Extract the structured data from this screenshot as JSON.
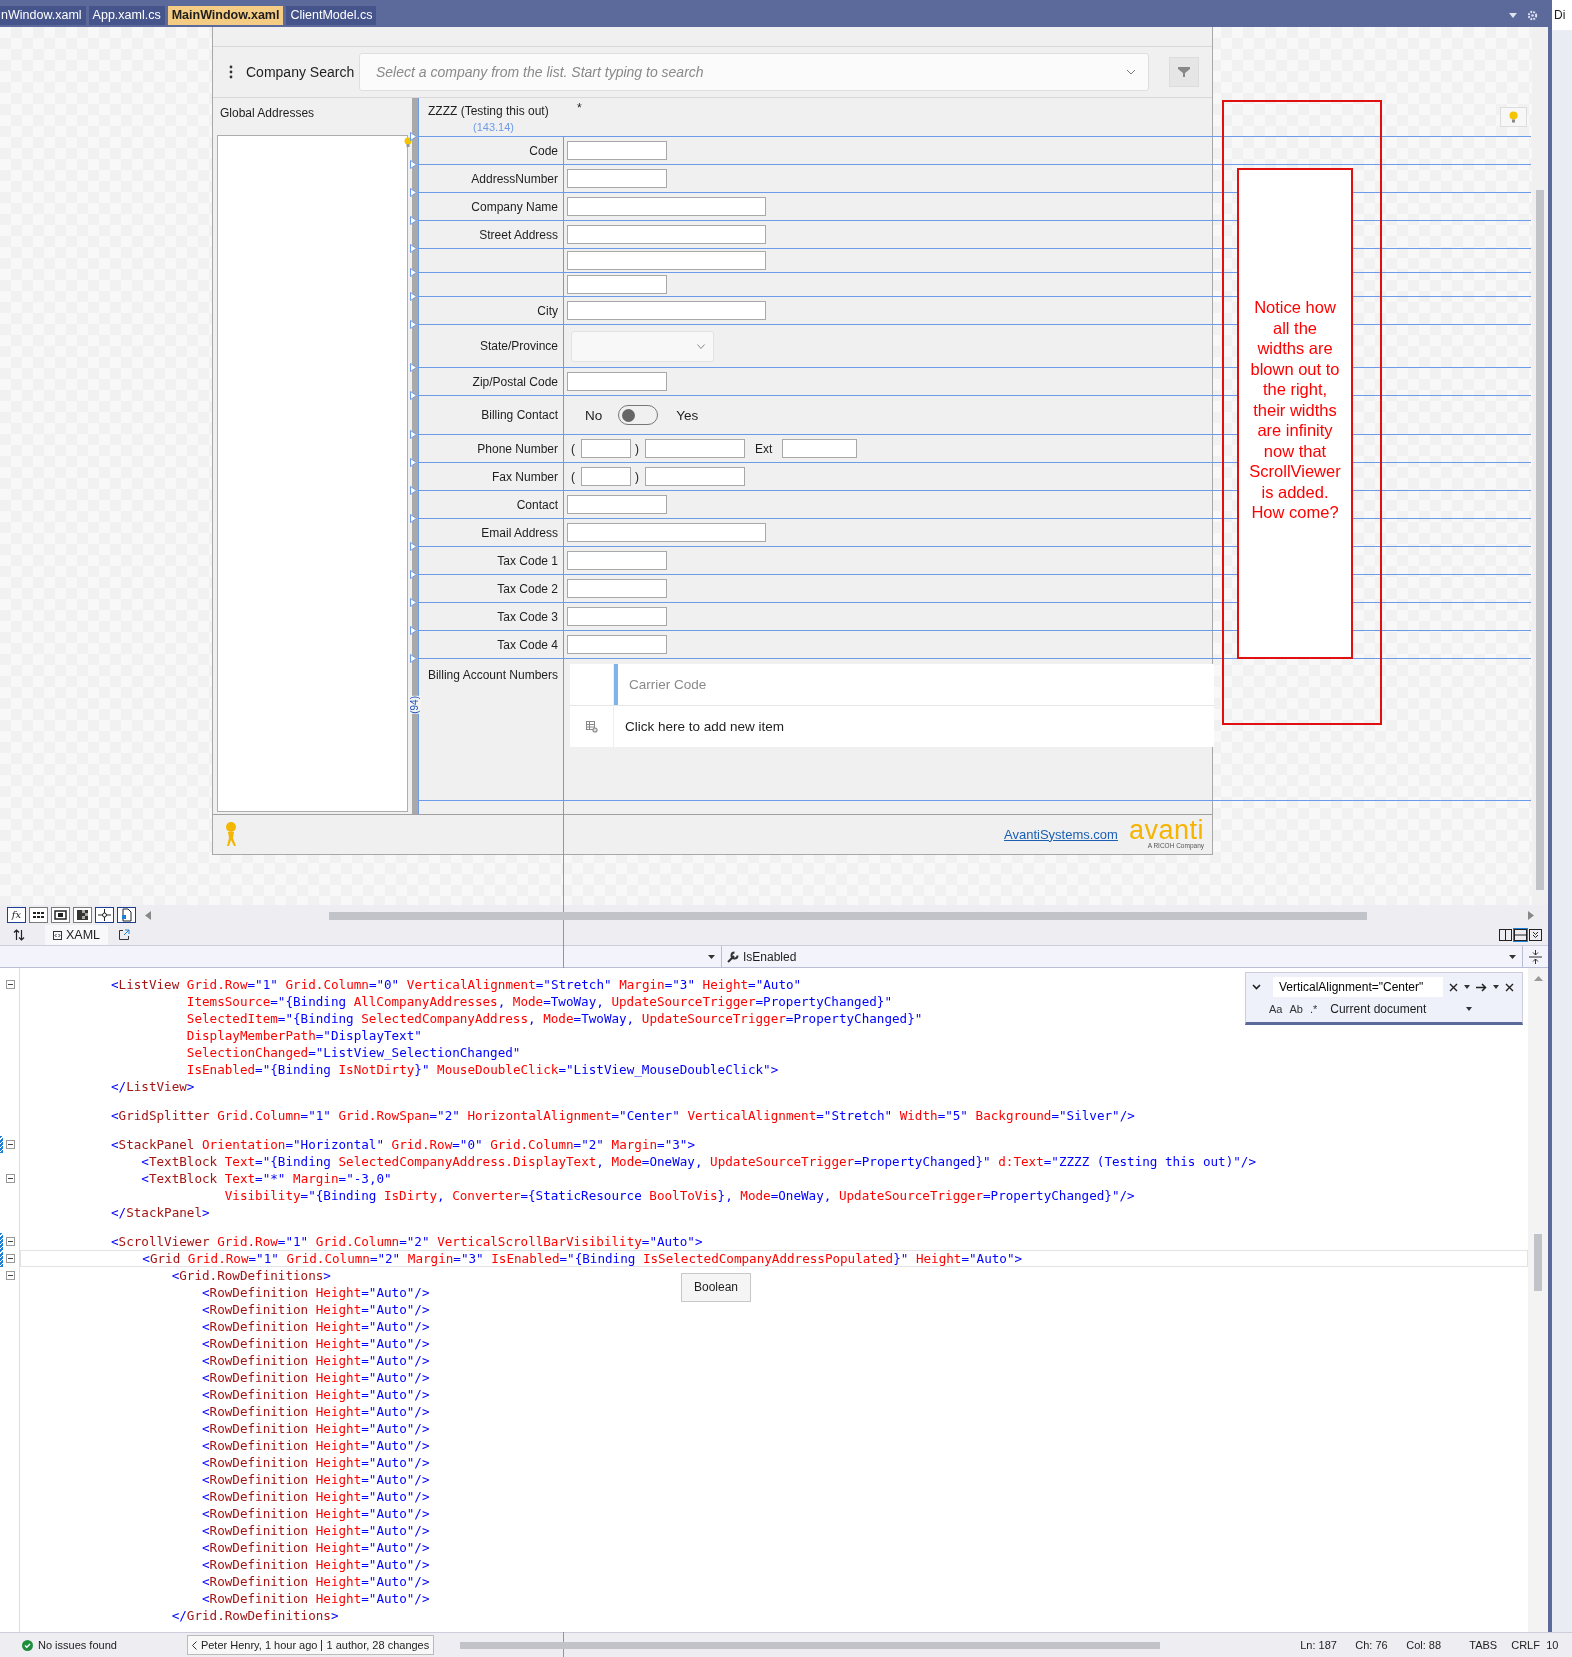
{
  "editor_tabs": [
    {
      "label": "nWindow.xaml",
      "selected": false
    },
    {
      "label": "App.xaml.cs",
      "selected": false
    },
    {
      "label": "MainWindow.xaml",
      "selected": true
    },
    {
      "label": "ClientModel.cs",
      "selected": false
    }
  ],
  "side_panel": {
    "title": "Di"
  },
  "preview": {
    "search": {
      "label": "Company Search",
      "placeholder": "Select a company from the list. Start typing to search"
    },
    "list_title": "Global Addresses",
    "header": {
      "title": "ZZZZ (Testing this out)",
      "dirty_mark": "*"
    },
    "width_adorner": "(143.14)",
    "height_adorner": "(94)",
    "fields": [
      {
        "kind": "text",
        "label": "Code",
        "wide": false
      },
      {
        "kind": "text",
        "label": "AddressNumber",
        "wide": false
      },
      {
        "kind": "text",
        "label": "Company Name",
        "wide": true
      },
      {
        "kind": "text",
        "label": "Street Address",
        "wide": true
      },
      {
        "kind": "text",
        "wide": true
      },
      {
        "kind": "text",
        "wide": false
      },
      {
        "kind": "text",
        "label": "City",
        "wide": true
      },
      {
        "kind": "combo",
        "label": "State/Province"
      },
      {
        "kind": "text",
        "label": "Zip/Postal Code",
        "wide": false
      },
      {
        "kind": "toggle",
        "label": "Billing Contact",
        "off_label": "No",
        "on_label": "Yes",
        "on": false
      },
      {
        "kind": "phone",
        "label": "Phone Number",
        "open": "(",
        "close": ")",
        "ext_label": "Ext"
      },
      {
        "kind": "phone",
        "label": "Fax Number",
        "open": "(",
        "close": ")"
      },
      {
        "kind": "text",
        "label": "Contact",
        "wide": false
      },
      {
        "kind": "text",
        "label": "Email Address",
        "wide": true
      },
      {
        "kind": "text",
        "label": "Tax Code 1",
        "wide": false
      },
      {
        "kind": "text",
        "label": "Tax Code 2",
        "wide": false
      },
      {
        "kind": "text",
        "label": "Tax Code 3",
        "wide": false
      },
      {
        "kind": "text",
        "label": "Tax Code 4",
        "wide": false
      },
      {
        "kind": "grid",
        "label": "Billing Account Numbers",
        "column": "Carrier Code",
        "add_row": "Click here to add new item"
      }
    ],
    "footer": {
      "link": "AvantiSystems.com",
      "logo": "avanti",
      "logo_tagline": "A RICOH Company"
    }
  },
  "annotation": {
    "text": "Notice how all the widths are blown out to the right, their widths are infinity now that ScrollViewer is added. How come?"
  },
  "designer_toolbar": {
    "formula_label": "fx"
  },
  "view_tab": {
    "label": "XAML"
  },
  "breadcrumb": {
    "member": "IsEnabled"
  },
  "editor": {
    "lines": [
      {
        "kind": "code",
        "text": "            <ListView Grid.Row=\"1\" Grid.Column=\"0\" VerticalAlignment=\"Stretch\" Margin=\"3\" Height=\"Auto\"",
        "fold": true,
        "changed": false,
        "current": false
      },
      {
        "kind": "code",
        "text": "                      ItemsSource=\"{Binding AllCompanyAddresses, Mode=TwoWay, UpdateSourceTrigger=PropertyChanged}\"",
        "fold": false,
        "changed": false,
        "current": false
      },
      {
        "kind": "code",
        "text": "                      SelectedItem=\"{Binding SelectedCompanyAddress, Mode=TwoWay, UpdateSourceTrigger=PropertyChanged}\"",
        "fold": false,
        "changed": false,
        "current": false
      },
      {
        "kind": "code",
        "text": "                      DisplayMemberPath=\"DisplayText\"",
        "fold": false,
        "changed": false,
        "current": false
      },
      {
        "kind": "code",
        "text": "                      SelectionChanged=\"ListView_SelectionChanged\"",
        "fold": false,
        "changed": false,
        "current": false
      },
      {
        "kind": "code",
        "text": "                      IsEnabled=\"{Binding IsNotDirty}\" MouseDoubleClick=\"ListView_MouseDoubleClick\">",
        "fold": false,
        "changed": false,
        "current": false
      },
      {
        "kind": "code",
        "text": "            </ListView>",
        "fold": false,
        "changed": false,
        "current": false
      },
      {
        "kind": "blank",
        "fold": false,
        "changed": false,
        "current": false
      },
      {
        "kind": "code",
        "text": "            <GridSplitter Grid.Column=\"1\" Grid.RowSpan=\"2\" HorizontalAlignment=\"Center\" VerticalAlignment=\"Stretch\" Width=\"5\" Background=\"Silver\"/>",
        "fold": false,
        "changed": false,
        "current": false
      },
      {
        "kind": "blank",
        "fold": false,
        "changed": false,
        "current": false
      },
      {
        "kind": "code",
        "text": "            <StackPanel Orientation=\"Horizontal\" Grid.Row=\"0\" Grid.Column=\"2\" Margin=\"3\">",
        "fold": true,
        "changed": true,
        "current": false
      },
      {
        "kind": "code",
        "text": "                <TextBlock Text=\"{Binding SelectedCompanyAddress.DisplayText, Mode=OneWay, UpdateSourceTrigger=PropertyChanged}\" d:Text=\"ZZZZ (Testing this out)\"/>",
        "fold": false,
        "changed": false,
        "current": false
      },
      {
        "kind": "code",
        "text": "                <TextBlock Text=\"*\" Margin=\"-3,0\"",
        "fold": true,
        "changed": false,
        "current": false
      },
      {
        "kind": "code",
        "text": "                           Visibility=\"{Binding IsDirty, Converter={StaticResource BoolToVis}, Mode=OneWay, UpdateSourceTrigger=PropertyChanged}\"/>",
        "fold": false,
        "changed": false,
        "current": false
      },
      {
        "kind": "code",
        "text": "            </StackPanel>",
        "fold": false,
        "changed": false,
        "current": false
      },
      {
        "kind": "blank",
        "fold": false,
        "changed": false,
        "current": false
      },
      {
        "kind": "code",
        "text": "            <ScrollViewer Grid.Row=\"1\" Grid.Column=\"2\" VerticalScrollBarVisibility=\"Auto\">",
        "fold": true,
        "changed": true,
        "current": false
      },
      {
        "kind": "code",
        "text": "                <Grid Grid.Row=\"1\" Grid.Column=\"2\" Margin=\"3\" IsEnabled=\"{Binding IsSelectedCompanyAddressPopulated}\" Height=\"Auto\">",
        "fold": true,
        "changed": true,
        "current": true
      },
      {
        "kind": "code",
        "text": "                    <Grid.RowDefinitions>",
        "fold": true,
        "changed": false,
        "current": false
      },
      {
        "kind": "code",
        "text": "                        <RowDefinition Height=\"Auto\"/>",
        "fold": false,
        "changed": false,
        "current": false
      },
      {
        "kind": "code",
        "text": "                        <RowDefinition Height=\"Auto\"/>",
        "fold": false,
        "changed": false,
        "current": false
      },
      {
        "kind": "code",
        "text": "                        <RowDefinition Height=\"Auto\"/>",
        "fold": false,
        "changed": false,
        "current": false
      },
      {
        "kind": "code",
        "text": "                        <RowDefinition Height=\"Auto\"/>",
        "fold": false,
        "changed": false,
        "current": false
      },
      {
        "kind": "code",
        "text": "                        <RowDefinition Height=\"Auto\"/>",
        "fold": false,
        "changed": false,
        "current": false
      },
      {
        "kind": "code",
        "text": "                        <RowDefinition Height=\"Auto\"/>",
        "fold": false,
        "changed": false,
        "current": false
      },
      {
        "kind": "code",
        "text": "                        <RowDefinition Height=\"Auto\"/>",
        "fold": false,
        "changed": false,
        "current": false
      },
      {
        "kind": "code",
        "text": "                        <RowDefinition Height=\"Auto\"/>",
        "fold": false,
        "changed": false,
        "current": false
      },
      {
        "kind": "code",
        "text": "                        <RowDefinition Height=\"Auto\"/>",
        "fold": false,
        "changed": false,
        "current": false
      },
      {
        "kind": "code",
        "text": "                        <RowDefinition Height=\"Auto\"/>",
        "fold": false,
        "changed": false,
        "current": false
      },
      {
        "kind": "code",
        "text": "                        <RowDefinition Height=\"Auto\"/>",
        "fold": false,
        "changed": false,
        "current": false
      },
      {
        "kind": "code",
        "text": "                        <RowDefinition Height=\"Auto\"/>",
        "fold": false,
        "changed": false,
        "current": false
      },
      {
        "kind": "code",
        "text": "                        <RowDefinition Height=\"Auto\"/>",
        "fold": false,
        "changed": false,
        "current": false
      },
      {
        "kind": "code",
        "text": "                        <RowDefinition Height=\"Auto\"/>",
        "fold": false,
        "changed": false,
        "current": false
      },
      {
        "kind": "code",
        "text": "                        <RowDefinition Height=\"Auto\"/>",
        "fold": false,
        "changed": false,
        "current": false
      },
      {
        "kind": "code",
        "text": "                        <RowDefinition Height=\"Auto\"/>",
        "fold": false,
        "changed": false,
        "current": false
      },
      {
        "kind": "code",
        "text": "                        <RowDefinition Height=\"Auto\"/>",
        "fold": false,
        "changed": false,
        "current": false
      },
      {
        "kind": "code",
        "text": "                        <RowDefinition Height=\"Auto\"/>",
        "fold": false,
        "changed": false,
        "current": false
      },
      {
        "kind": "code",
        "text": "                        <RowDefinition Height=\"Auto\"/>",
        "fold": false,
        "changed": false,
        "current": false
      },
      {
        "kind": "code",
        "text": "                    </Grid.RowDefinitions>",
        "fold": false,
        "changed": false,
        "current": false
      }
    ],
    "tooltip": "Boolean",
    "find": {
      "value": "VerticalAlignment=\"Center\"",
      "options": [
        "Aa",
        "Ab",
        ".*"
      ],
      "scope": "Current document"
    }
  },
  "status_bar": {
    "issues": "No issues found",
    "last_change": "Peter Henry, 1 hour ago",
    "authors": "1 author, 28 changes",
    "line": "Ln: 187",
    "char": "Ch: 76",
    "column": "Col: 88",
    "indent": "TABS",
    "line_ending": "CRLF",
    "zoom": "10"
  }
}
